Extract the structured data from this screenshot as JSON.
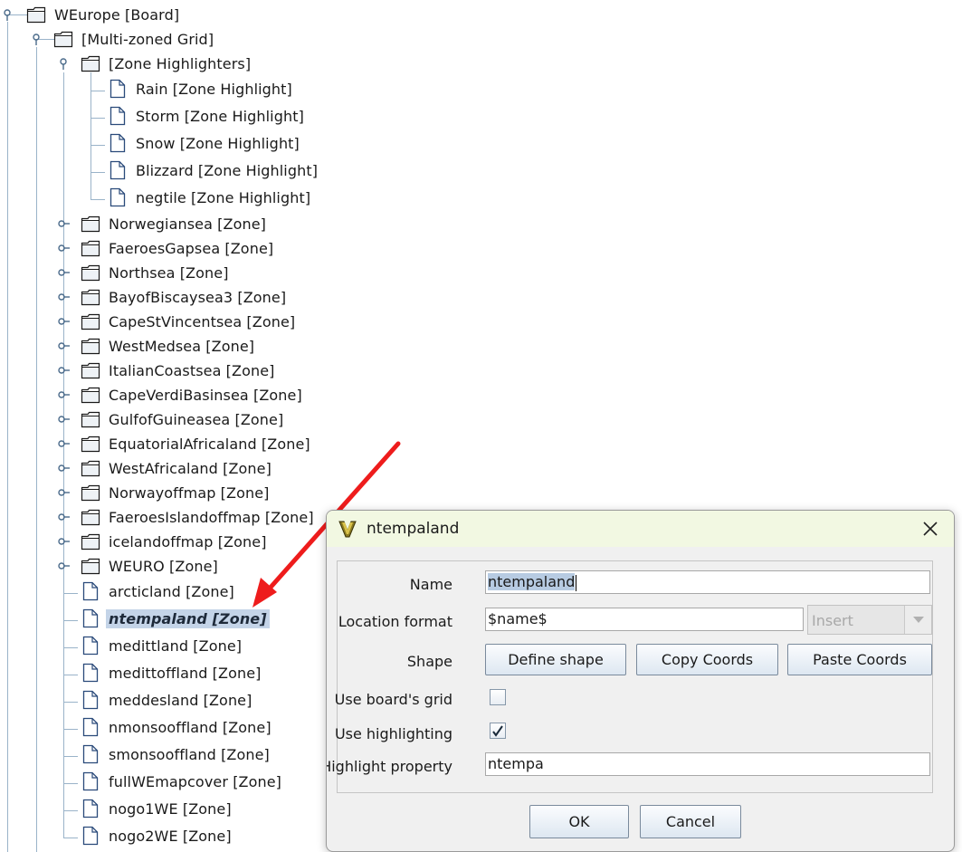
{
  "tree": {
    "nodes": [
      {
        "label": "WEurope [Board]",
        "type": "folder",
        "handle": "expanded"
      },
      {
        "label": "[Multi-zoned Grid]",
        "type": "folder",
        "handle": "expanded"
      },
      {
        "label": "[Zone Highlighters]",
        "type": "folder",
        "handle": "expanded"
      },
      {
        "label": "Rain [Zone Highlight]",
        "type": "leaf"
      },
      {
        "label": "Storm [Zone Highlight]",
        "type": "leaf"
      },
      {
        "label": "Snow [Zone Highlight]",
        "type": "leaf"
      },
      {
        "label": "Blizzard [Zone Highlight]",
        "type": "leaf"
      },
      {
        "label": "negtile [Zone Highlight]",
        "type": "leaf"
      },
      {
        "label": "Norwegiansea [Zone]",
        "type": "folder",
        "handle": "collapsed"
      },
      {
        "label": "FaeroesGapsea [Zone]",
        "type": "folder",
        "handle": "collapsed"
      },
      {
        "label": "Northsea [Zone]",
        "type": "folder",
        "handle": "collapsed"
      },
      {
        "label": "BayofBiscaysea3 [Zone]",
        "type": "folder",
        "handle": "collapsed"
      },
      {
        "label": "CapeStVincentsea [Zone]",
        "type": "folder",
        "handle": "collapsed"
      },
      {
        "label": "WestMedsea [Zone]",
        "type": "folder",
        "handle": "collapsed"
      },
      {
        "label": "ItalianCoastsea [Zone]",
        "type": "folder",
        "handle": "collapsed"
      },
      {
        "label": "CapeVerdiBasinsea [Zone]",
        "type": "folder",
        "handle": "collapsed"
      },
      {
        "label": "GulfofGuineasea [Zone]",
        "type": "folder",
        "handle": "collapsed"
      },
      {
        "label": "EquatorialAfricaland [Zone]",
        "type": "folder",
        "handle": "collapsed"
      },
      {
        "label": "WestAfricaland [Zone]",
        "type": "folder",
        "handle": "collapsed"
      },
      {
        "label": "Norwayoffmap [Zone]",
        "type": "folder",
        "handle": "collapsed"
      },
      {
        "label": "FaeroesIslandoffmap [Zone]",
        "type": "folder",
        "handle": "collapsed"
      },
      {
        "label": "icelandoffmap [Zone]",
        "type": "folder",
        "handle": "collapsed"
      },
      {
        "label": "WEURO [Zone]",
        "type": "folder",
        "handle": "collapsed"
      },
      {
        "label": "arcticland [Zone]",
        "type": "leaf"
      },
      {
        "label": "ntempaland [Zone]",
        "type": "leaf",
        "selected": true
      },
      {
        "label": "medittland [Zone]",
        "type": "leaf"
      },
      {
        "label": "medittoffland [Zone]",
        "type": "leaf"
      },
      {
        "label": "meddesland [Zone]",
        "type": "leaf"
      },
      {
        "label": "nmonsooffland [Zone]",
        "type": "leaf"
      },
      {
        "label": "smonsooffland [Zone]",
        "type": "leaf"
      },
      {
        "label": "fullWEmapcover [Zone]",
        "type": "leaf"
      },
      {
        "label": "nogo1WE [Zone]",
        "type": "leaf"
      },
      {
        "label": "nogo2WE [Zone]",
        "type": "leaf"
      }
    ]
  },
  "dialog": {
    "title": "ntempaland",
    "name_label": "Name",
    "name_value": "ntempaland",
    "location_format_label": "Location format",
    "location_format_value": "$name$",
    "insert_placeholder": "Insert",
    "shape_label": "Shape",
    "define_shape_button": "Define shape",
    "copy_coords_button": "Copy Coords",
    "paste_coords_button": "Paste Coords",
    "use_boards_grid_label": "Use board's grid",
    "use_boards_grid_checked": false,
    "use_highlighting_label": "Use highlighting",
    "use_highlighting_checked": true,
    "highlight_property_label": "Highlight property",
    "highlight_property_value": "ntempa",
    "ok_button": "OK",
    "cancel_button": "Cancel"
  },
  "colors": {
    "selection": "#c4d4e8",
    "title_bar": "#f2f8e2",
    "annotation_arrow": "#ee1c1c"
  }
}
